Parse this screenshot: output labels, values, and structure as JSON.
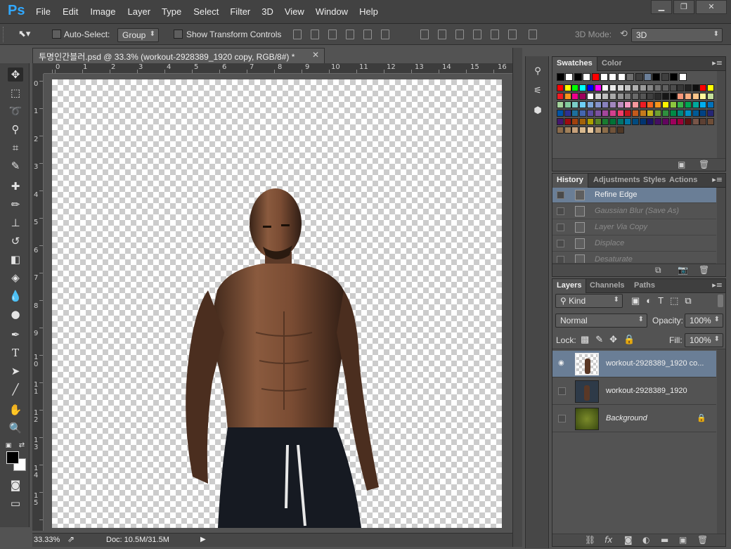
{
  "app": {
    "logo": "Ps"
  },
  "menu": [
    "File",
    "Edit",
    "Image",
    "Layer",
    "Type",
    "Select",
    "Filter",
    "3D",
    "View",
    "Window",
    "Help"
  ],
  "window_controls": {
    "minimize": "▁",
    "restore": "❐",
    "close": "✕"
  },
  "options": {
    "auto_select_label": "Auto-Select:",
    "auto_select_value": "Group",
    "show_transform_label": "Show Transform Controls",
    "mode_label": "3D Mode:",
    "mode_value": "3D"
  },
  "document": {
    "tab_title": "투명인간블러.psd @ 33.3% (workout-2928389_1920 copy, RGB/8#) *",
    "close": "✕"
  },
  "ruler": {
    "h": [
      "0",
      "1",
      "2",
      "3",
      "4",
      "5",
      "6",
      "7",
      "8",
      "9",
      "10",
      "11",
      "12",
      "13",
      "14",
      "15",
      "16"
    ],
    "v": [
      "0",
      "1",
      "2",
      "3",
      "4",
      "5",
      "6",
      "7",
      "8",
      "9",
      "1 0",
      "1 1",
      "1 2",
      "1 3",
      "1 4",
      "1 5",
      "1 6"
    ]
  },
  "status": {
    "zoom": "33.33%",
    "doc": "Doc: 10.5M/31.5M"
  },
  "swatches": {
    "tabs": [
      "Swatches",
      "Color"
    ],
    "colors": [
      "#000000",
      "#ffffff",
      "#000000",
      "#ffffff",
      "#ff0000",
      "#ffffff",
      "#ffffff",
      "#ffffff",
      "#6f6f6f",
      "#3f3f3f",
      "#6b7f99",
      "#000000",
      "#3f3f3f",
      "#000000",
      "#ffffff",
      "#ff0000",
      "#ffff00",
      "#00ff00",
      "#00ffff",
      "#0000ff",
      "#ff00ff",
      "#ffffff",
      "#ebebeb",
      "#d7d7d7",
      "#c3c3c3",
      "#afafaf",
      "#9b9b9b",
      "#878787",
      "#737373",
      "#5f5f5f",
      "#4b4b4b",
      "#373737",
      "#232323",
      "#0f0f0f",
      "#ff0000",
      "#ffff00",
      "#ee1c24",
      "#f7941d",
      "#ec008c",
      "#9e005d",
      "#ffffff",
      "#d3d3d3",
      "#bebebe",
      "#a9a9a9",
      "#949494",
      "#7f7f7f",
      "#6a6a6a",
      "#555555",
      "#404040",
      "#2b2b2b",
      "#161616",
      "#000000",
      "#f7977a",
      "#f9ad81",
      "#fdc68a",
      "#fff79a",
      "#c4df9b",
      "#a3d39c",
      "#82ca9d",
      "#7bcdc8",
      "#6ecff6",
      "#7ea7d8",
      "#8493ca",
      "#8882be",
      "#a187be",
      "#bc8dbf",
      "#f49ac2",
      "#f6989d",
      "#ed1c24",
      "#f26522",
      "#f7941d",
      "#fff200",
      "#8dc63f",
      "#39b54a",
      "#00a651",
      "#00a99d",
      "#00aeef",
      "#0072bc",
      "#0054a6",
      "#2e3192",
      "#1d6f9c",
      "#4466b0",
      "#5b4ea0",
      "#7b52a0",
      "#a3469b",
      "#d3408e",
      "#ef3e6a",
      "#c4161c",
      "#c45a1c",
      "#c47a1c",
      "#c4b41c",
      "#6fa031",
      "#2f8f3e",
      "#008a45",
      "#00887e",
      "#0091c4",
      "#005a96",
      "#004284",
      "#262675",
      "#44166e",
      "#9e0b0f",
      "#a0410d",
      "#a36209",
      "#aba000",
      "#598527",
      "#197b30",
      "#007236",
      "#00746b",
      "#0076a3",
      "#004b80",
      "#003471",
      "#1b1464",
      "#440e62",
      "#630460",
      "#9e005d",
      "#9e0039",
      "#5f1010",
      "#795548",
      "#5c4033",
      "#6f4e37",
      "#8b6b4b",
      "#a0805a",
      "#c6a07a",
      "#d8b98f",
      "#e8c9a0",
      "#b59670",
      "#8c6d4a",
      "#70533a",
      "#4e3826"
    ]
  },
  "history": {
    "tabs": [
      "History",
      "Adjustments",
      "Styles",
      "Actions"
    ],
    "rows": [
      "Refine Edge",
      "Gaussian Blur (Save As)",
      "Layer Via Copy",
      "Displace",
      "Desaturate"
    ]
  },
  "layers": {
    "tabs": [
      "Layers",
      "Channels",
      "Paths"
    ],
    "kind": "Kind",
    "blend": "Normal",
    "opacity_label": "Opacity:",
    "opacity": "100%",
    "lock_label": "Lock:",
    "fill_label": "Fill:",
    "fill": "100%",
    "items": [
      {
        "name": "workout-2928389_1920 co...",
        "visible": true
      },
      {
        "name": "workout-2928389_1920",
        "visible": false
      },
      {
        "name": "Background",
        "visible": false
      }
    ]
  }
}
